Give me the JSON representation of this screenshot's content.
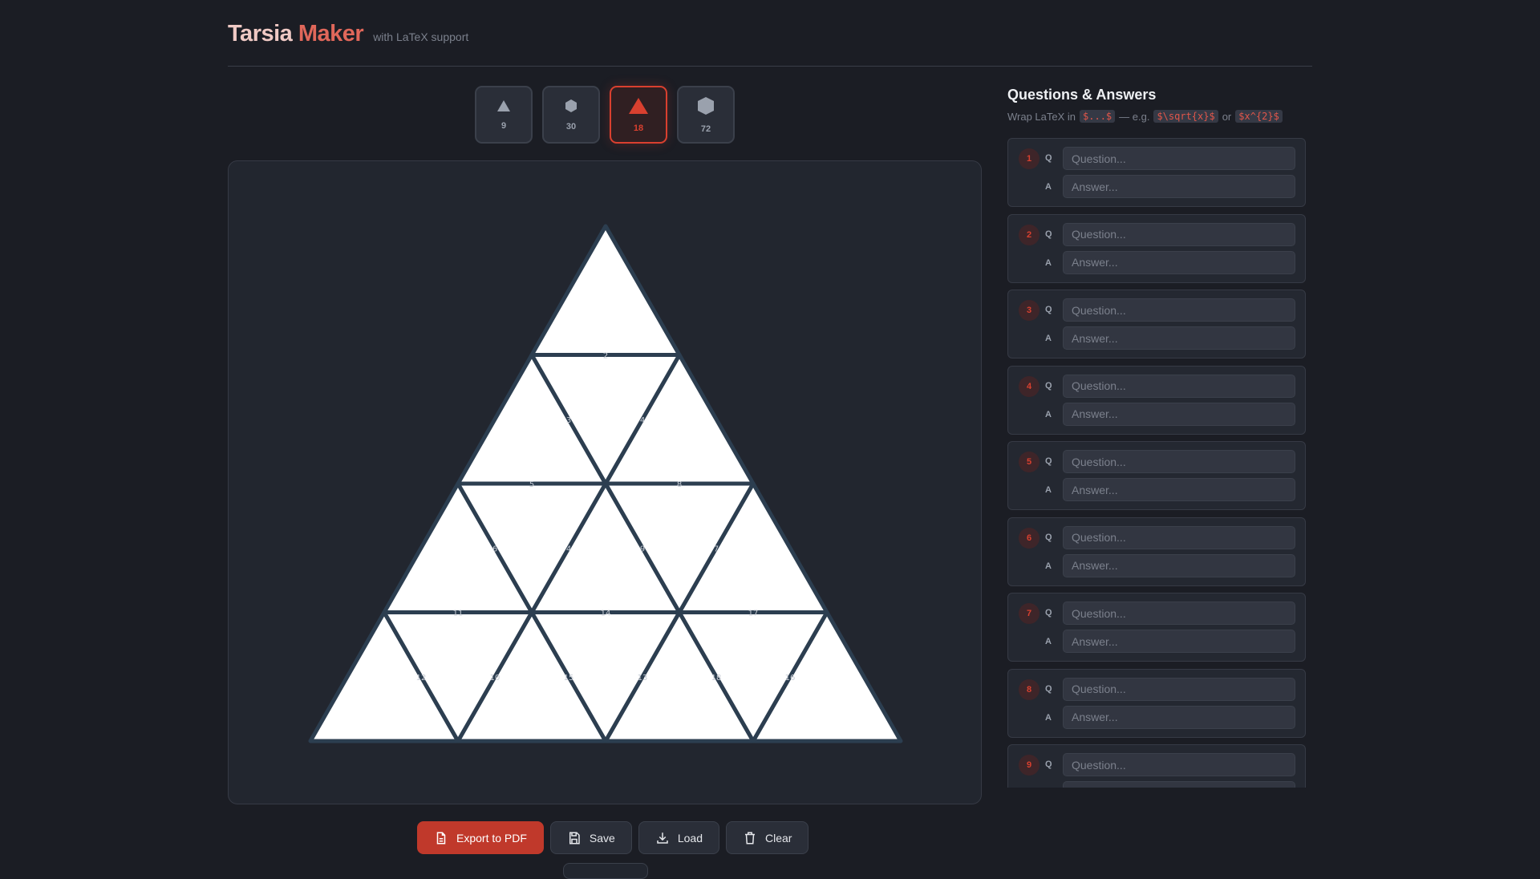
{
  "header": {
    "title_part1": "Tarsia",
    "title_part2": "Maker",
    "subtitle": "with LaTeX support"
  },
  "shapes": [
    {
      "icon": "small-triangle-icon",
      "count": "9",
      "active": false
    },
    {
      "icon": "small-hexagon-icon",
      "count": "30",
      "active": false
    },
    {
      "icon": "large-triangle-icon",
      "count": "18",
      "active": true
    },
    {
      "icon": "large-hexagon-icon",
      "count": "72",
      "active": false
    }
  ],
  "puzzle": {
    "rows": 4,
    "edge_labels": {
      "h": [
        [
          "2"
        ],
        [
          "5",
          "8"
        ],
        [
          "11",
          "14",
          "17"
        ]
      ],
      "s": [
        [
          "3",
          "4"
        ],
        [
          "6",
          "4",
          "9",
          "7"
        ],
        [
          "12",
          "10",
          "15",
          "13",
          "18",
          "16"
        ]
      ]
    }
  },
  "colors": {
    "accent": "#d9402f",
    "edge": "#2c3e50",
    "tile": "#ffffff"
  },
  "actions": {
    "export": "Export to PDF",
    "save": "Save",
    "load": "Load",
    "clear": "Clear"
  },
  "panel": {
    "title": "Questions & Answers",
    "hint_prefix": "Wrap LaTeX in",
    "code1": "$...$",
    "hint_mid": "— e.g.",
    "code2": "$\\sqrt{x}$",
    "hint_or": "or",
    "code3": "$x^{2}$",
    "q_label": "Q",
    "a_label": "A",
    "q_placeholder": "Question...",
    "a_placeholder": "Answer...",
    "items": [
      "1",
      "2",
      "3",
      "4",
      "5",
      "6",
      "7",
      "8",
      "9"
    ]
  }
}
